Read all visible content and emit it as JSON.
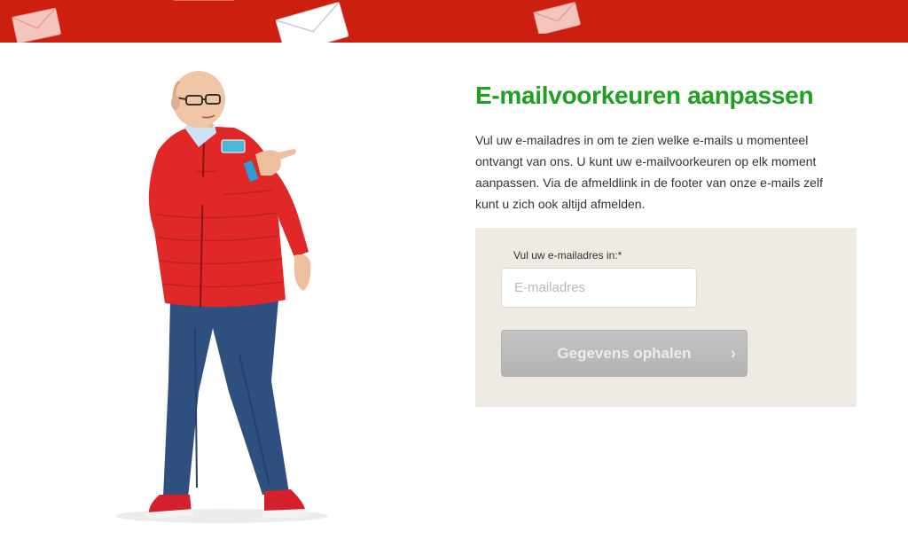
{
  "header": {
    "brand_color": "#cc1f10",
    "decorations": [
      "envelope-icon",
      "envelope-icon",
      "envelope-icon",
      "envelope-icon"
    ]
  },
  "hero": {
    "image": "man-in-red-jacket-pointing"
  },
  "main": {
    "title": "E-mailvoorkeuren aanpassen",
    "title_color": "#1fa021",
    "intro": "Vul uw e-mailadres in om te zien welke e-mails u momenteel ontvangt van ons. U kunt uw e-mailvoorkeuren op elk moment aanpassen. Via de afmeldlink in de footer van onze e-mails zelf kunt u zich ook altijd afmelden."
  },
  "form": {
    "email_label": "Vul uw e-mailadres in:*",
    "email_placeholder": "E-mailadres",
    "email_value": "",
    "submit_label": "Gegevens ophalen",
    "submit_icon": "chevron-right-icon",
    "panel_color": "#efebe4"
  }
}
